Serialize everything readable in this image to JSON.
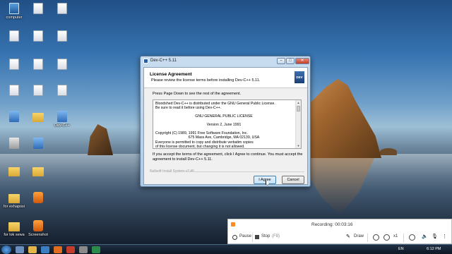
{
  "desktop": {
    "icons": [
      {
        "label": "computer",
        "type": "pc"
      },
      {
        "label": "",
        "type": "file"
      },
      {
        "label": "",
        "type": "file"
      },
      {
        "label": "",
        "type": "file"
      },
      {
        "label": "",
        "type": "file"
      },
      {
        "label": "",
        "type": "file"
      },
      {
        "label": "",
        "type": "file"
      },
      {
        "label": "",
        "type": "file"
      },
      {
        "label": "",
        "type": "file"
      },
      {
        "label": "",
        "type": "file"
      },
      {
        "label": "",
        "type": "file"
      },
      {
        "label": "",
        "type": "file"
      },
      {
        "label": "",
        "type": "blue"
      },
      {
        "label": "",
        "type": "folder"
      },
      {
        "label": "Dev-C++",
        "type": "blue"
      },
      {
        "label": "",
        "type": "gray"
      },
      {
        "label": "",
        "type": "blue"
      },
      {
        "label": "",
        "type": "folder"
      },
      {
        "label": "",
        "type": "folder"
      },
      {
        "label": "for exhaposi",
        "type": "folder"
      },
      {
        "label": "",
        "type": "orange"
      },
      {
        "label": "for lok sewa",
        "type": "folder"
      },
      {
        "label": "Screenshot",
        "type": "orange"
      }
    ]
  },
  "dialog": {
    "title": "Dev-C++ 5.11",
    "header_title": "License Agreement",
    "header_subtitle": "Please review the license terms before installing Dev-C++ 5.11.",
    "logo_text": "DEV",
    "instruction": "Press Page Down to see the rest of the agreement.",
    "license_lines": [
      "Bloodshed Dev-C++ is distributed under the GNU General Public License.",
      "Be sure to read it before using Dev-C++.",
      "",
      "GNU GENERAL PUBLIC LICENSE",
      "",
      "Version 2, June 1991",
      "",
      "Copyright (C) 1989, 1991 Free Software Foundation, Inc.",
      "675 Mass Ave, Cambridge, MA 02139, USA",
      "Everyone is permitted to copy and distribute verbatim copies",
      "of this license document, but changing it is not allowed."
    ],
    "accept_text": "If you accept the terms of the agreement, click I Agree to continue. You must accept the agreement to install Dev-C++ 5.11.",
    "branding": "Nullsoft Install System v2.46",
    "agree_label": "I Agree",
    "cancel_label": "Cancel"
  },
  "recorder": {
    "status": "Recording: 00:03:16",
    "pause_label": "Pause",
    "stop_label": "Stop",
    "stop_shortcut": "(F8)",
    "draw_label": "Draw",
    "zoom_label": "x1"
  },
  "taskbar": {
    "language": "EN",
    "time": "6:12 PM"
  }
}
